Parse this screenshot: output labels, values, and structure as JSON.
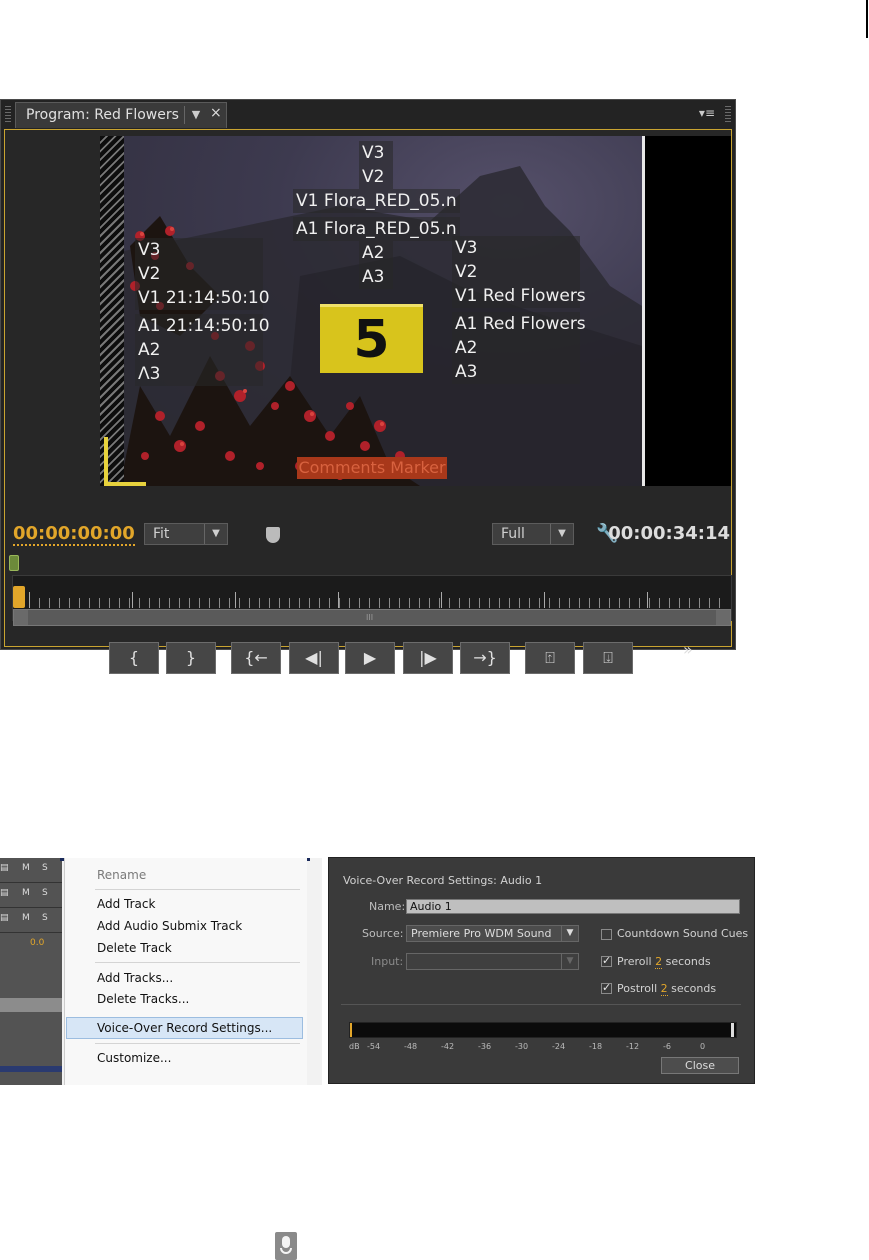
{
  "monitor": {
    "tab_title": "Program: Red Flowers",
    "tab_dropdown": "▼",
    "tab_close": "×",
    "panel_menu": "▾≡",
    "overlay_center": [
      "V3",
      "V2",
      "V1 Flora_RED_05.n",
      "A1 Flora_RED_05.n",
      "A2",
      "A3"
    ],
    "overlay_left": [
      "V3",
      "V2",
      "V1 21:14:50:10",
      "A1 21:14:50:10",
      "A2",
      "Λ3"
    ],
    "overlay_right": [
      "V3",
      "V2",
      "V1 Red Flowers",
      "A1 Red Flowers",
      "A2",
      "A3"
    ],
    "countdown_number": "5",
    "comments_marker": "Comments Marker",
    "timecode_current": "00:00:00:00",
    "timecode_duration": "00:00:34:14",
    "zoom_value": "Fit",
    "resolution_value": "Full",
    "scroll_grip": "III",
    "playhead_fraction": 0.0,
    "transport_buttons": [
      {
        "icon": "mark-in-icon",
        "glyph": "{"
      },
      {
        "icon": "mark-out-icon",
        "glyph": "}"
      },
      {
        "icon": "go-to-in-icon",
        "glyph": "{←"
      },
      {
        "icon": "step-back-icon",
        "glyph": "◀|"
      },
      {
        "icon": "play-icon",
        "glyph": "▶"
      },
      {
        "icon": "step-forward-icon",
        "glyph": "|▶"
      },
      {
        "icon": "go-to-out-icon",
        "glyph": "→}"
      },
      {
        "icon": "lift-icon",
        "glyph": "⍐"
      },
      {
        "icon": "extract-icon",
        "glyph": "⍗"
      }
    ],
    "more_glyph": "»",
    "add_glyph": "+",
    "accent_color": "#e2a62a",
    "border_color": "#c9a431"
  },
  "context_menu": {
    "tracks": [
      {
        "m": "M",
        "s": "S"
      },
      {
        "m": "M",
        "s": "S"
      },
      {
        "m": "M",
        "s": "S"
      }
    ],
    "track_volume": "0.0",
    "items": [
      {
        "label": "Rename",
        "disabled": true
      },
      {
        "label": "Add Track"
      },
      {
        "label": "Add Audio Submix Track"
      },
      {
        "label": "Delete Track"
      },
      {
        "label": "Add Tracks..."
      },
      {
        "label": "Delete Tracks..."
      },
      {
        "label": "Voice-Over Record Settings...",
        "highlighted": true
      },
      {
        "label": "Customize..."
      }
    ],
    "highlight_color": "#d7e6f6"
  },
  "voiceover": {
    "title": "Voice-Over Record Settings: Audio 1",
    "name_label": "Name:",
    "name_value": "Audio 1",
    "source_label": "Source:",
    "source_value": "Premiere Pro WDM Sound",
    "input_label": "Input:",
    "input_value": "",
    "countdown_label": "Countdown Sound Cues",
    "countdown_checked": false,
    "preroll_label": "Preroll",
    "preroll_value": "2",
    "preroll_unit": "seconds",
    "preroll_checked": true,
    "postroll_label": "Postroll",
    "postroll_value": "2",
    "postroll_unit": "seconds",
    "postroll_checked": true,
    "db_scale": [
      "dB",
      "-54",
      "-48",
      "-42",
      "-36",
      "-30",
      "-24",
      "-18",
      "-12",
      "-6",
      "0"
    ],
    "close_label": "Close"
  },
  "icons": {
    "microphone": "microphone-icon"
  }
}
